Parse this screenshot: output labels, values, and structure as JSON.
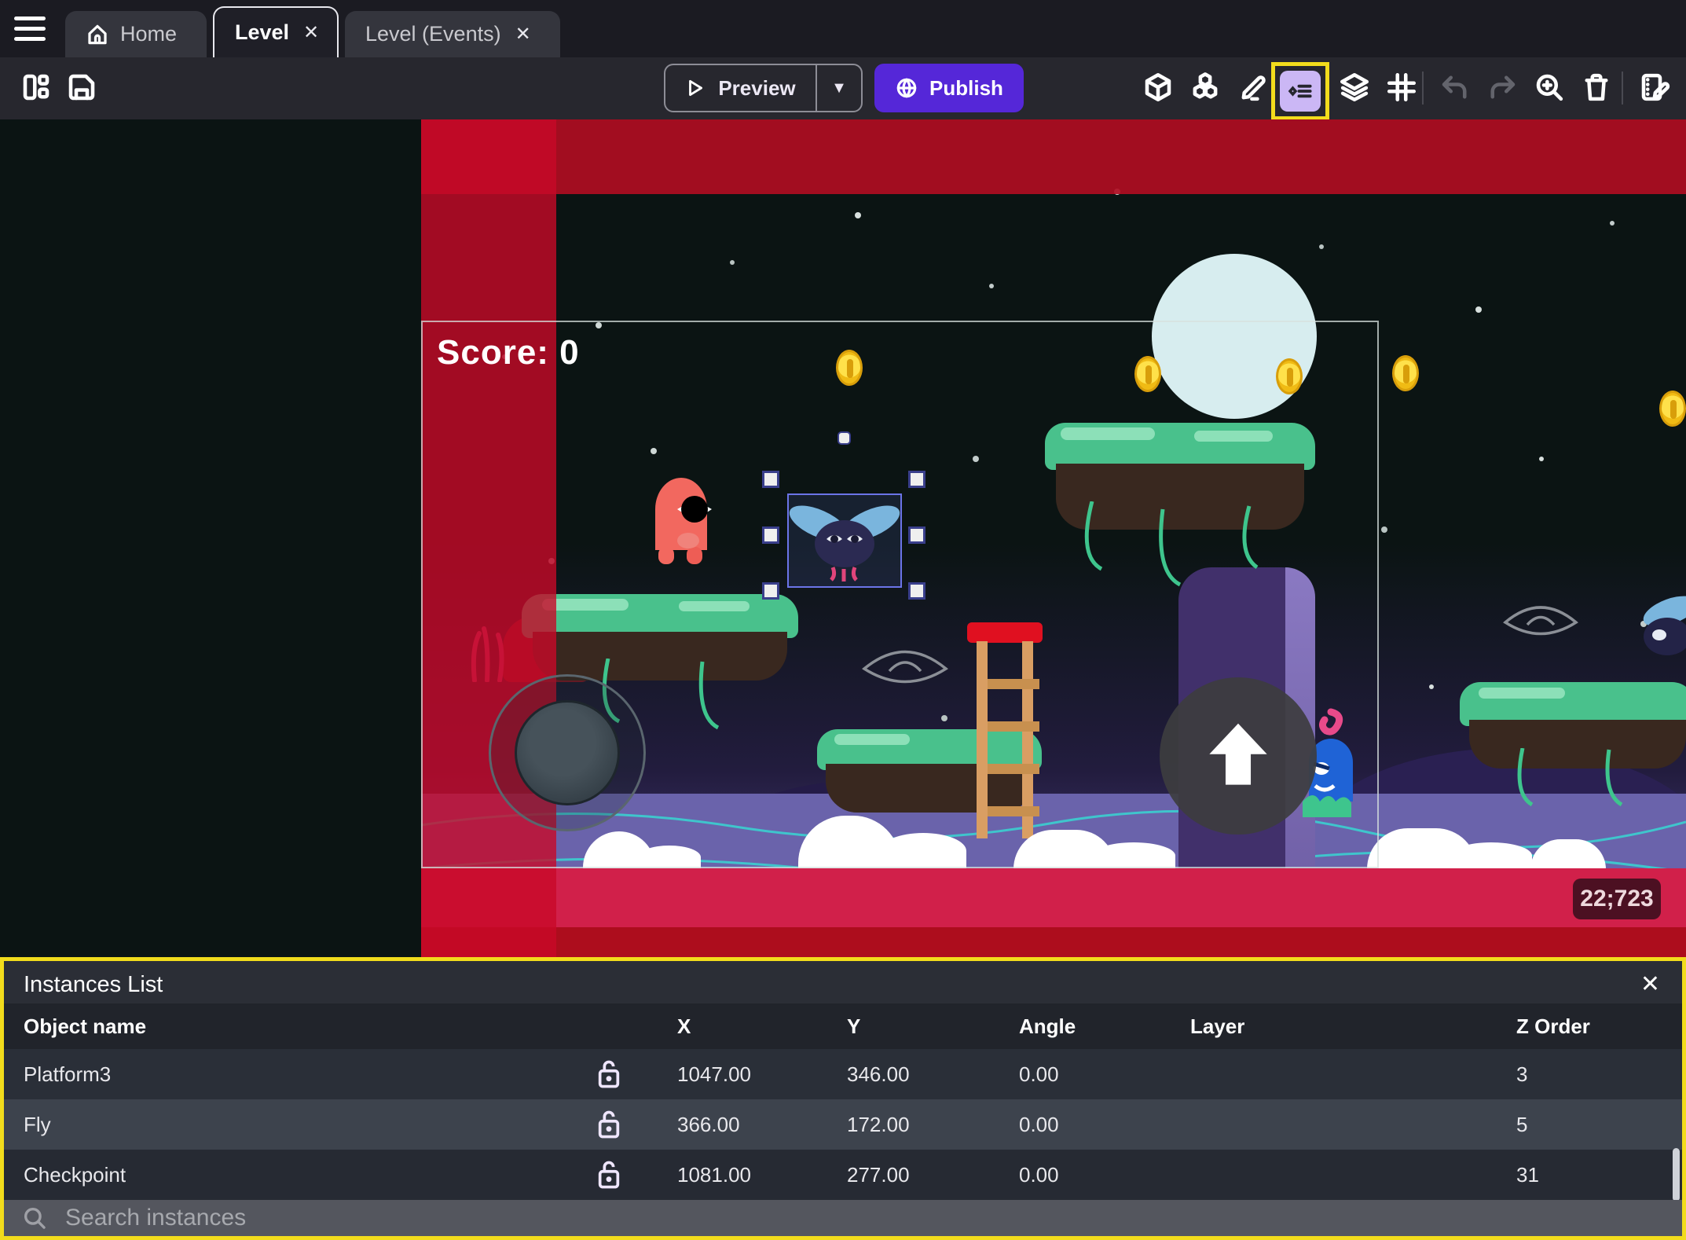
{
  "tabs": {
    "home": "Home",
    "level": "Level",
    "level_events": "Level (Events)",
    "close_glyph": "✕"
  },
  "toolbar": {
    "preview_label": "Preview",
    "caret_glyph": "▼",
    "publish_label": "Publish"
  },
  "canvas": {
    "score_text": "Score: 0",
    "coords_badge": "22;723"
  },
  "panel": {
    "title": "Instances List",
    "close_glyph": "✕",
    "columns": [
      "Object name",
      "X",
      "Y",
      "Angle",
      "Layer",
      "Z Order"
    ],
    "rows": [
      {
        "name": "Platform3",
        "x": "1047.00",
        "y": "346.00",
        "angle": "0.00",
        "layer": "",
        "z": "3"
      },
      {
        "name": "Fly",
        "x": "366.00",
        "y": "172.00",
        "angle": "0.00",
        "layer": "",
        "z": "5"
      },
      {
        "name": "Checkpoint",
        "x": "1081.00",
        "y": "277.00",
        "angle": "0.00",
        "layer": "",
        "z": "31"
      }
    ],
    "search_placeholder": "Search instances"
  },
  "colors": {
    "publish_accent": "#5527d8",
    "highlight_yellow": "#f2dc1c",
    "selection_blue": "#6b74e8",
    "danger_red_band": "#c00928",
    "icon_highlight_bg": "#cbb7f5"
  }
}
